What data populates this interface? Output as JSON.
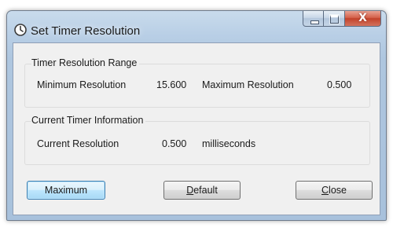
{
  "window": {
    "title": "Set Timer Resolution",
    "icon": "clock-icon",
    "caption_buttons": {
      "minimize": "minimize-icon",
      "maximize": "maximize-icon",
      "close_glyph": "X"
    }
  },
  "range_group": {
    "title": "Timer Resolution Range",
    "min_label": "Minimum Resolution",
    "min_value": "15.600",
    "max_label": "Maximum Resolution",
    "max_value": "0.500"
  },
  "current_group": {
    "title": "Current Timer Information",
    "current_label": "Current Resolution",
    "current_value": "0.500",
    "unit": "milliseconds"
  },
  "buttons": {
    "maximum": "Maximum",
    "default_accel": "D",
    "default_rest": "efault",
    "close_accel": "C",
    "close_rest": "lose"
  },
  "colors": {
    "title_bar": "#b9cfe6",
    "close_button": "#c8462e",
    "focus_button": "#3c7fb1",
    "client_bg": "#f0f0f0"
  }
}
